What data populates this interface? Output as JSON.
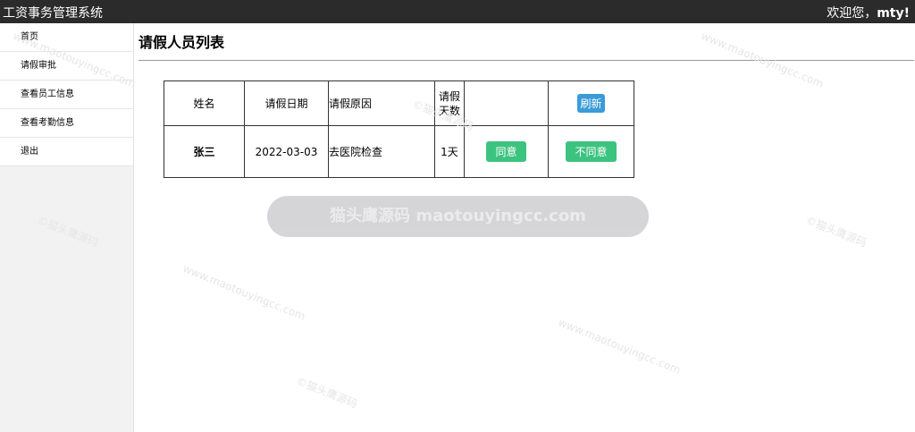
{
  "header": {
    "app_title": "工资事务管理系统",
    "welcome_prefix": "欢迎您，",
    "username": "mty!"
  },
  "sidebar": {
    "items": [
      {
        "label": "首页"
      },
      {
        "label": "请假审批"
      },
      {
        "label": "查看员工信息"
      },
      {
        "label": "查看考勤信息"
      },
      {
        "label": "退出"
      }
    ]
  },
  "main": {
    "title": "请假人员列表",
    "table": {
      "headers": {
        "name": "姓名",
        "date": "请假日期",
        "reason": "请假原因",
        "days": "请假天数",
        "refresh_button": "刷新"
      },
      "rows": [
        {
          "name": "张三",
          "date": "2022-03-03",
          "reason": "去医院检查",
          "days": "1天",
          "agree_button": "同意",
          "disagree_button": "不同意"
        }
      ]
    }
  },
  "overlay": {
    "text": "猫头鹰源码 maotouyingcc.com"
  },
  "watermark": {
    "text": "www.maotouyingcc.com",
    "mark": "©猫头鹰源码"
  },
  "colors": {
    "topbar": "#2b2b2b",
    "sidebar": "#f2f2f2",
    "refresh_button": "#3a9bd8",
    "action_button": "#3dc380"
  }
}
